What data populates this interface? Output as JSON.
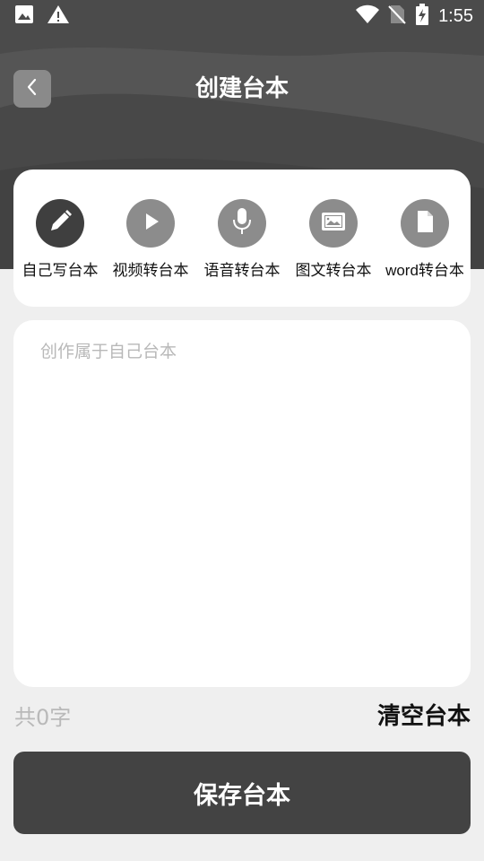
{
  "status_bar": {
    "time": "1:55",
    "left_icons": [
      "image-icon",
      "warning-icon"
    ],
    "right_icons": [
      "wifi-icon",
      "no-sim-icon",
      "battery-charging-icon"
    ]
  },
  "header": {
    "title": "创建台本",
    "back_icon": "chevron-left-icon",
    "background_color": "#4b4b4b"
  },
  "tools": [
    {
      "label": "自己写台本",
      "icon": "pencil-icon",
      "active": true
    },
    {
      "label": "视频转台本",
      "icon": "play-icon",
      "active": false
    },
    {
      "label": "语音转台本",
      "icon": "microphone-icon",
      "active": false
    },
    {
      "label": "图文转台本",
      "icon": "picture-icon",
      "active": false
    },
    {
      "label": "word转台本",
      "icon": "document-icon",
      "active": false
    }
  ],
  "editor": {
    "placeholder": "创作属于自己台本",
    "value": ""
  },
  "footer": {
    "char_count": "共0字",
    "clear_label": "清空台本",
    "save_label": "保存台本"
  },
  "colors": {
    "active_icon": "#3f3f3f",
    "inactive_icon": "#8c8c8c",
    "save_button": "#434343",
    "page_background": "#efefef"
  }
}
